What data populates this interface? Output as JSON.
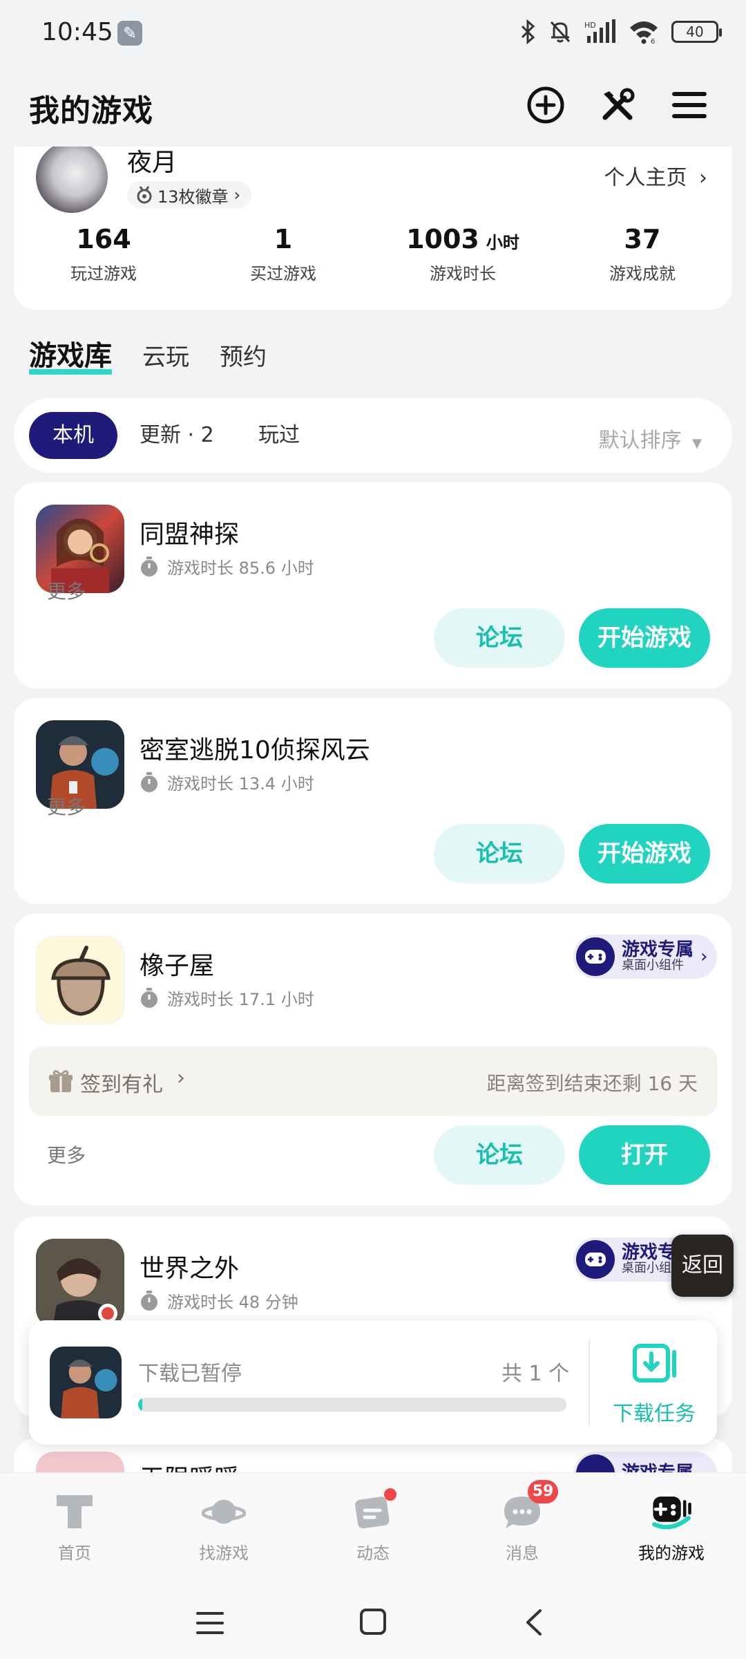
{
  "status_bar": {
    "time": "10:45",
    "wrench_icon": "wrench-icon",
    "battery": "40"
  },
  "header": {
    "title": "我的游戏"
  },
  "profile": {
    "username": "夜月",
    "badges": "13枚徽章",
    "homepage_link": "个人主页",
    "stats": [
      {
        "value": "164",
        "unit": "",
        "label": "玩过游戏"
      },
      {
        "value": "1",
        "unit": "",
        "label": "买过游戏"
      },
      {
        "value": "1003",
        "unit": "小时",
        "label": "游戏时长"
      },
      {
        "value": "37",
        "unit": "",
        "label": "游戏成就"
      }
    ]
  },
  "library_tabs": [
    "游戏库",
    "云玩",
    "预约"
  ],
  "filters": {
    "chips": [
      "本机",
      "更新 · 2",
      "玩过"
    ],
    "sort": "默认排序"
  },
  "games": [
    {
      "name": "同盟神探",
      "playtime": "游戏时长 85.6 小时",
      "more": "更多",
      "forum": "论坛",
      "action": "开始游戏"
    },
    {
      "name": "密室逃脱10侦探风云",
      "playtime": "游戏时长 13.4 小时",
      "more": "更多",
      "forum": "论坛",
      "action": "开始游戏"
    },
    {
      "name": "橡子屋",
      "playtime": "游戏时长 17.1 小时",
      "more": "更多",
      "forum": "论坛",
      "action": "打开",
      "exclusive_title": "游戏专属",
      "exclusive_sub": "桌面小组件",
      "checkin_label": "签到有礼",
      "checkin_status": "距离签到结束还剩 16 天"
    },
    {
      "name": "世界之外",
      "playtime": "游戏时长 48 分钟",
      "exclusive_title": "游戏专属",
      "exclusive_sub": "桌面小组件"
    },
    {
      "name": "无限暖暖",
      "exclusive_title": "游戏专属"
    }
  ],
  "floating_back": "返回",
  "download": {
    "status": "下载已暂停",
    "count": "共 1 个",
    "task_label": "下载任务",
    "progress": 0.01
  },
  "bottom_nav": [
    {
      "label": "首页",
      "icon": "home-icon"
    },
    {
      "label": "找游戏",
      "icon": "planet-icon"
    },
    {
      "label": "动态",
      "icon": "feed-icon"
    },
    {
      "label": "消息",
      "icon": "message-icon",
      "badge": "59"
    },
    {
      "label": "我的游戏",
      "icon": "gamepad-icon"
    }
  ],
  "colors": {
    "accent": "#21d4c0",
    "brand_dark": "#1e1b7a"
  }
}
